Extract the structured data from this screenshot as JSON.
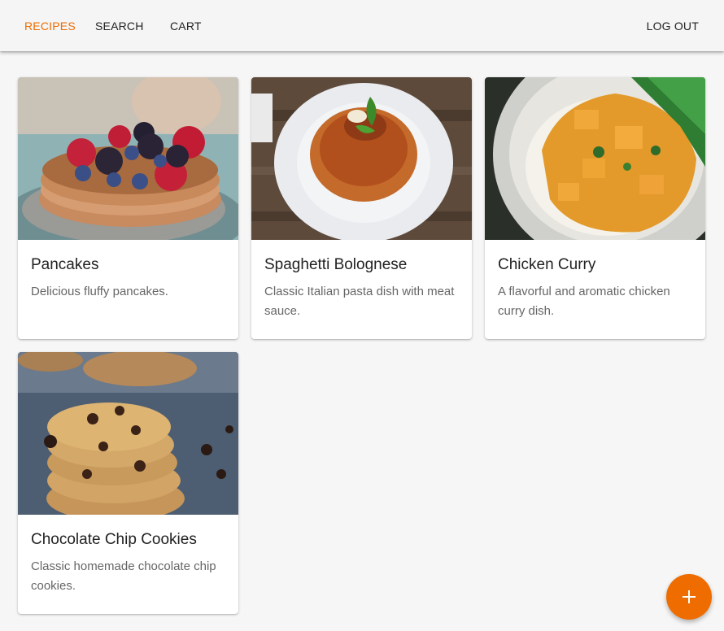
{
  "nav": {
    "recipes": "RECIPES",
    "search": "SEARCH",
    "cart": "CART",
    "logout": "LOG OUT",
    "active_color": "#ef6c00"
  },
  "recipes": [
    {
      "title": "Pancakes",
      "description": "Delicious fluffy pancakes.",
      "image": "pancakes-photo"
    },
    {
      "title": "Spaghetti Bolognese",
      "description": "Classic Italian pasta dish with meat sauce.",
      "image": "spaghetti-photo"
    },
    {
      "title": "Chicken Curry",
      "description": "A flavorful and aromatic chicken curry dish.",
      "image": "curry-photo"
    },
    {
      "title": "Chocolate Chip Cookies",
      "description": "Classic homemade chocolate chip cookies.",
      "image": "cookies-photo"
    }
  ],
  "fab": {
    "icon": "plus-icon",
    "color": "#ef6c00"
  }
}
